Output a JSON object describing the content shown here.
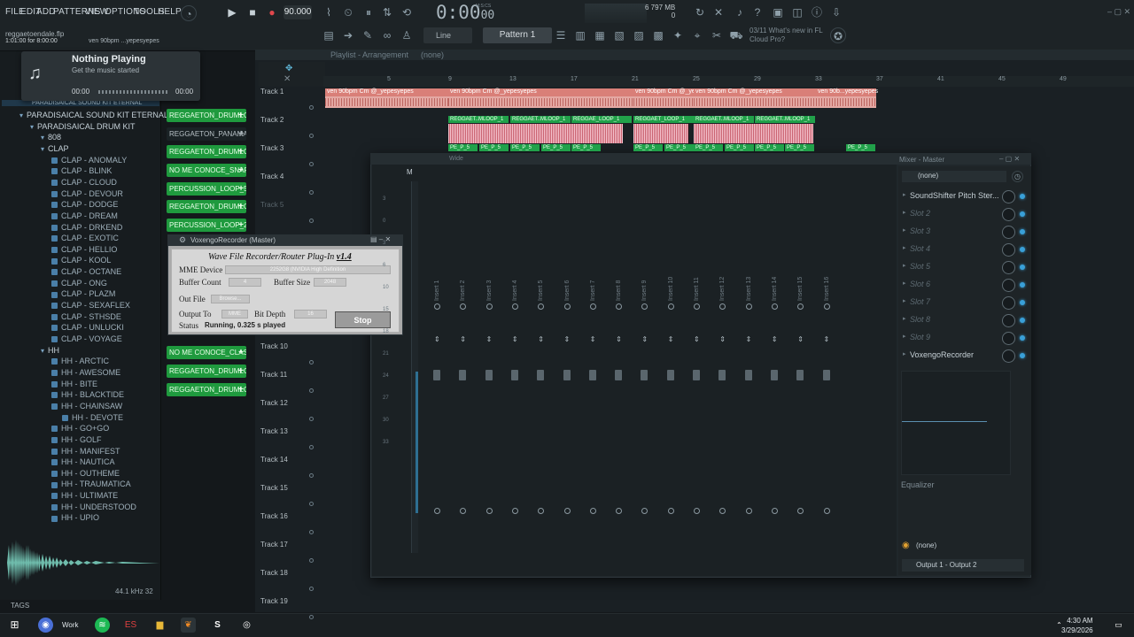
{
  "menu": [
    "FILE",
    "EDIT",
    "ADD",
    "PATTERNS",
    "VIEW",
    "OPTIONS",
    "TOOLS",
    "HELP"
  ],
  "project_file": "reggaetoendale.flp",
  "hint_text": "1:01:00 for 8:00:00",
  "hint_pattern": "ven 90bpm ...yepesyepes",
  "tempo": "90.000",
  "time": {
    "main": "0:00",
    "sub": "00",
    "unit": "M:S:CS"
  },
  "cpu": {
    "line1": "6    797 MB",
    "line2": "0"
  },
  "pattern": "Pattern 1",
  "snap": "Line",
  "news": {
    "line1": "03/11  What's new in FL",
    "line2": "Cloud Pro?"
  },
  "now_playing": {
    "title": "Nothing Playing",
    "sub": "Get the music started",
    "start": "00:00",
    "end": "00:00"
  },
  "browser": {
    "items": [
      {
        "label": "PARADISAICAL SOUND KIT ETERNAL",
        "kind": "folder",
        "depth": 0
      },
      {
        "label": "PARADISAICAL DRUM KIT",
        "kind": "folder",
        "depth": 1
      },
      {
        "label": "808",
        "kind": "folder",
        "depth": 2
      },
      {
        "label": "CLAP",
        "kind": "folder",
        "depth": 2
      },
      {
        "label": "CLAP - ANOMALY",
        "kind": "file",
        "depth": 3
      },
      {
        "label": "CLAP - BLINK",
        "kind": "file",
        "depth": 3
      },
      {
        "label": "CLAP - CLOUD",
        "kind": "file",
        "depth": 3
      },
      {
        "label": "CLAP - DEVOUR",
        "kind": "file",
        "depth": 3
      },
      {
        "label": "CLAP - DODGE",
        "kind": "file",
        "depth": 3
      },
      {
        "label": "CLAP - DREAM",
        "kind": "file",
        "depth": 3
      },
      {
        "label": "CLAP - DRKEND",
        "kind": "file",
        "depth": 3
      },
      {
        "label": "CLAP - EXOTIC",
        "kind": "file",
        "depth": 3
      },
      {
        "label": "CLAP - HELLIO",
        "kind": "file",
        "depth": 3
      },
      {
        "label": "CLAP - KOOL",
        "kind": "file",
        "depth": 3
      },
      {
        "label": "CLAP - OCTANE",
        "kind": "file",
        "depth": 3
      },
      {
        "label": "CLAP - ONG",
        "kind": "file",
        "depth": 3
      },
      {
        "label": "CLAP - PLAZM",
        "kind": "file",
        "depth": 3
      },
      {
        "label": "CLAP - SEXAFLEX",
        "kind": "file",
        "depth": 3
      },
      {
        "label": "CLAP - STHSDE",
        "kind": "file",
        "depth": 3
      },
      {
        "label": "CLAP - UNLUCKI",
        "kind": "file",
        "depth": 3
      },
      {
        "label": "CLAP - VOYAGE",
        "kind": "file",
        "depth": 3
      },
      {
        "label": "HH",
        "kind": "folder",
        "depth": 2
      },
      {
        "label": "HH - ARCTIC",
        "kind": "file",
        "depth": 3
      },
      {
        "label": "HH - AWESOME",
        "kind": "file",
        "depth": 3
      },
      {
        "label": "HH - BITE",
        "kind": "file",
        "depth": 3
      },
      {
        "label": "HH - BLACKTIDE",
        "kind": "file",
        "depth": 3
      },
      {
        "label": "HH - CHAINSAW",
        "kind": "file",
        "depth": 3
      },
      {
        "label": "HH - DEVOTE",
        "kind": "file",
        "depth": 4
      },
      {
        "label": "HH - GO+GO",
        "kind": "file",
        "depth": 3
      },
      {
        "label": "HH - GOLF",
        "kind": "file",
        "depth": 3
      },
      {
        "label": "HH - MANIFEST",
        "kind": "file",
        "depth": 3
      },
      {
        "label": "HH - NAUTICA",
        "kind": "file",
        "depth": 3
      },
      {
        "label": "HH - OUTHEME",
        "kind": "file",
        "depth": 3
      },
      {
        "label": "HH - TRAUMATICA",
        "kind": "file",
        "depth": 3
      },
      {
        "label": "HH - ULTIMATE",
        "kind": "file",
        "depth": 3
      },
      {
        "label": "HH - UNDERSTOOD",
        "kind": "file",
        "depth": 3
      },
      {
        "label": "HH - UPIO",
        "kind": "file",
        "depth": 3
      }
    ],
    "sample_info": "44.1 kHz 32",
    "tags_label": "TAGS"
  },
  "channels": [
    {
      "label": "REGGAETON_DRUMLO...",
      "active": true
    },
    {
      "label": "REGGAETON_PANAMA...",
      "active": false
    },
    {
      "label": "REGGAETON_DRUMLO...",
      "active": true
    },
    {
      "label": "NO ME CONOCE_SNAR...",
      "active": true
    },
    {
      "label": "PERCUSSION_LOOP_5",
      "active": true
    },
    {
      "label": "REGGAETON_DRUMLO...",
      "active": true
    },
    {
      "label": "PERCUSSION_LOOP_2",
      "active": true
    },
    {
      "label": "NO ME CONOCE_CLASS...",
      "active": true
    },
    {
      "label": "REGGAETON_DRUMLO...",
      "active": true
    },
    {
      "label": "REGGAETON_DRUMLO...",
      "active": true
    }
  ],
  "playlist": {
    "title": "Playlist - Arrangement",
    "sub": "(none)",
    "ruler": [
      "5",
      "9",
      "13",
      "17",
      "21",
      "25",
      "29",
      "33",
      "37",
      "41",
      "45",
      "49"
    ],
    "tracks": [
      "Track 1",
      "Track 2",
      "Track 3",
      "Track 4",
      "Track 5",
      "Track 10",
      "Track 11",
      "Track 12",
      "Track 13",
      "Track 14",
      "Track 15",
      "Track 16",
      "Track 17",
      "Track 18",
      "Track 19"
    ],
    "audio_clips": [
      "ven 90bpm Cm @_yepesyepes",
      "ven 90bpm Cm @_yepesyepes",
      "ven 90bpm Cm @_yepesyepes",
      "ven 90bpm Cm @_yepesyepes",
      "ven 90b...yepesyepes"
    ],
    "loop_clips": [
      "REGGAET..MLOOP_1",
      "REGGAET..MLOOP_1",
      "REGGAE_LOOP_1",
      "REGGAET_LOOP_1",
      "REGGAET..MLOOP_1",
      "REGGAET..MLOOP_1"
    ],
    "pe_clip": "PE_P_5"
  },
  "mixer": {
    "title": "Mixer - Master",
    "wide": "Wide",
    "master_label": "M",
    "inserts": [
      "Insert 1",
      "Insert 2",
      "Insert 3",
      "Insert 4",
      "Insert 5",
      "Insert 6",
      "Insert 7",
      "Insert 8",
      "Insert 9",
      "Insert 10",
      "Insert 11",
      "Insert 12",
      "Insert 13",
      "Insert 14",
      "Insert 15",
      "Insert 16"
    ],
    "preset": "(none)",
    "slots": [
      {
        "label": "SoundShifter Pitch Ster...",
        "active": true
      },
      {
        "label": "Slot 2",
        "active": false
      },
      {
        "label": "Slot 3",
        "active": false
      },
      {
        "label": "Slot 4",
        "active": false
      },
      {
        "label": "Slot 5",
        "active": false
      },
      {
        "label": "Slot 6",
        "active": false
      },
      {
        "label": "Slot 7",
        "active": false
      },
      {
        "label": "Slot 8",
        "active": false
      },
      {
        "label": "Slot 9",
        "active": false
      },
      {
        "label": "VoxengoRecorder",
        "active": true
      }
    ],
    "equalizer": "Equalizer",
    "out_none": "(none)",
    "output": "Output 1 - Output 2",
    "scale": [
      "3",
      "0",
      "3",
      "6",
      "10",
      "15",
      "18",
      "21",
      "24",
      "27",
      "30",
      "33"
    ]
  },
  "vox": {
    "window_title": "VoxengoRecorder (Master)",
    "heading": "Wave File Recorder/Router Plug-In",
    "version": "v1.4",
    "mme_label": "MME Device",
    "mme_value": "2252G8 (NVIDIA High Definition",
    "buffer_count_label": "Buffer Count",
    "buffer_count": "4",
    "buffer_size_label": "Buffer Size",
    "buffer_size": "2048",
    "out_file_label": "Out File",
    "browse": "Browse...",
    "output_to_label": "Output To",
    "output_to": "MME",
    "bit_depth_label": "Bit Depth",
    "bit_depth": "16",
    "status_label": "Status",
    "status": "Running, 0.325 s played",
    "stop": "Stop"
  },
  "taskbar": {
    "time": "4:30 AM",
    "date": "3/29/2026",
    "work_label": "Work"
  },
  "colors": {
    "accent_green": "#1f9a3e",
    "clip_red": "#d97f78",
    "led_blue": "#39a0d8"
  }
}
